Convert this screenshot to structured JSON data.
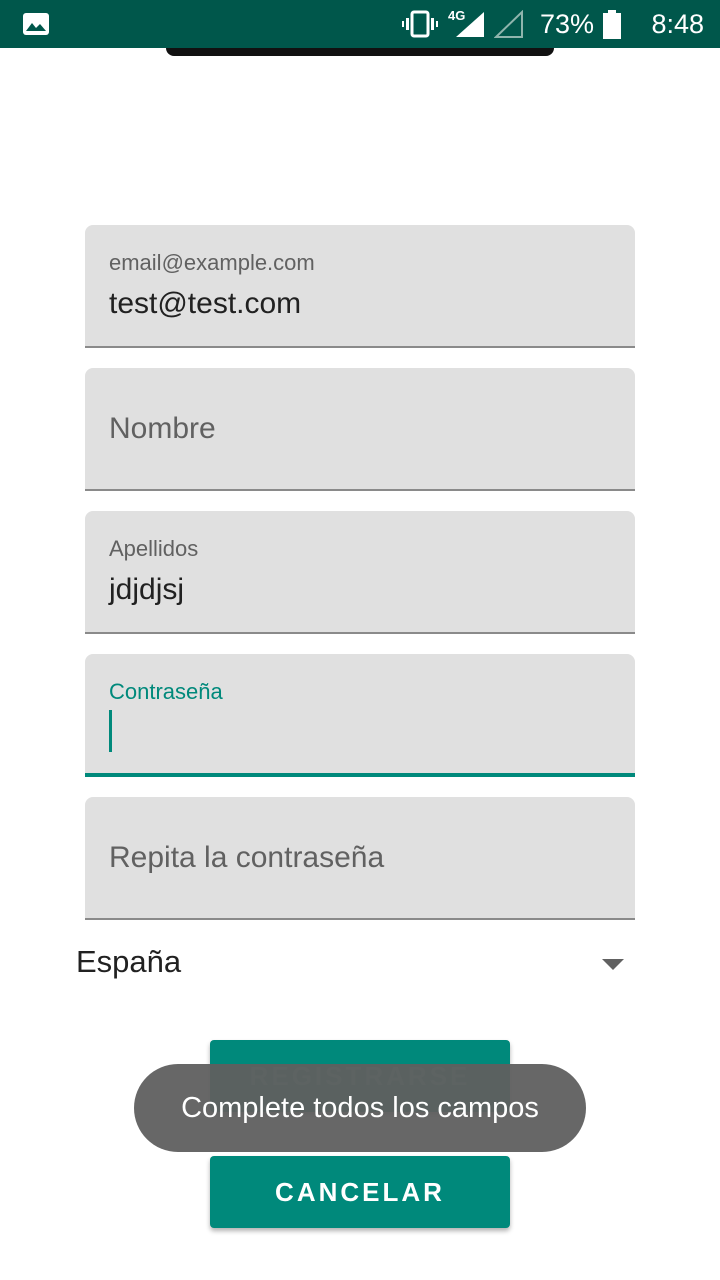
{
  "status_bar": {
    "network": "4G",
    "battery": "73%",
    "time": "8:48",
    "icons": [
      "image-icon",
      "vibrate-icon",
      "signal-icon",
      "signal-empty-icon",
      "battery-icon"
    ]
  },
  "form": {
    "email": {
      "label": "email@example.com",
      "value": "test@test.com"
    },
    "nombre": {
      "placeholder": "Nombre"
    },
    "apellidos": {
      "label": "Apellidos",
      "value": "jdjdjsj"
    },
    "contrasena": {
      "label": "Contraseña"
    },
    "repita": {
      "placeholder": "Repita la contraseña"
    },
    "country": {
      "selected": "España"
    }
  },
  "buttons": {
    "register": "REGISTRARSE",
    "cancel": "CANCELAR"
  },
  "toast": {
    "message": "Complete todos los campos"
  },
  "colors": {
    "status_bar": "#00574b",
    "accent": "#00897b",
    "field_bg": "#e0e0e0",
    "toast_bg": "#5f5f5f"
  }
}
